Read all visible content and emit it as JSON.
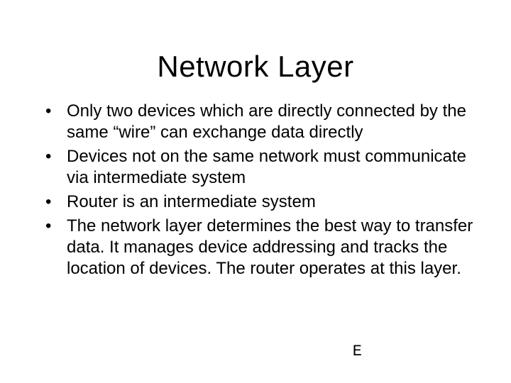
{
  "slide": {
    "title": "Network Layer",
    "bullets": [
      "Only two devices which are directly connected by the same “wire” can exchange data directly",
      "Devices not on the same network must communicate via intermediate system",
      "Router is an intermediate system",
      "The network layer determines the best way to transfer data.  It manages device addressing and tracks the location of devices.  The router operates at this layer."
    ],
    "footer_mark": "E"
  }
}
